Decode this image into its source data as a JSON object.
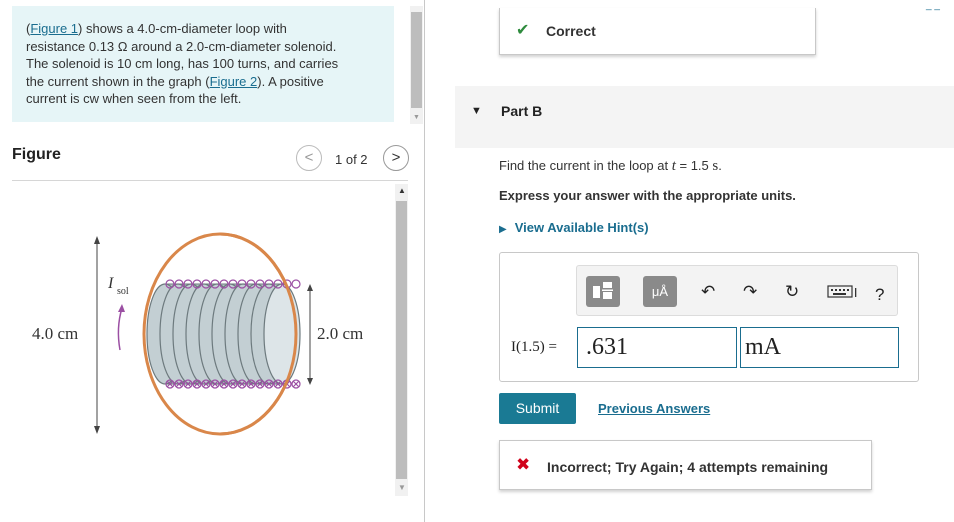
{
  "problem": {
    "fig1_link": "Figure 1",
    "line1_after": ") shows a 4.0-cm-diameter loop with",
    "line2": "resistance 0.13 Ω around a 2.0-cm-diameter solenoid.",
    "line3": "The solenoid is 10 cm long, has 100 turns, and carries",
    "line4_before": "the current shown in the graph (",
    "fig2_link": "Figure 2",
    "line4_after": "). A positive",
    "line5": "current is cw when seen from the left."
  },
  "figure": {
    "title": "Figure",
    "page_count": "1 of 2",
    "loop_label": "4.0 cm",
    "solenoid_label": "2.0 cm",
    "current_label": "I",
    "current_sub": "sol",
    "loop_color": "#d9874a",
    "solenoid_color": "#b7c3c7",
    "coil_color": "#9b4fa3"
  },
  "feedback_top": {
    "text": "Correct",
    "color": "#2e8b3d"
  },
  "part": {
    "label": "Part B"
  },
  "question": {
    "text_before": "Find the current in the loop at ",
    "var": "t",
    "text_mid": " = 1.5 ",
    "unit": "s",
    "text_end": ".",
    "instruction": "Express your answer with the appropriate units.",
    "hints": "View Available Hint(s)"
  },
  "toolbar": {
    "units_btn": "μÅ",
    "help": "?"
  },
  "answer": {
    "label": "I(1.5) =",
    "value": ".631",
    "unit": "mA"
  },
  "actions": {
    "submit": "Submit",
    "previous_answers": "Previous Answers"
  },
  "feedback_bottom": {
    "text": "Incorrect; Try Again; 4 attempts remaining",
    "color": "#d0021b"
  },
  "accent_color": "#1a6d8f"
}
